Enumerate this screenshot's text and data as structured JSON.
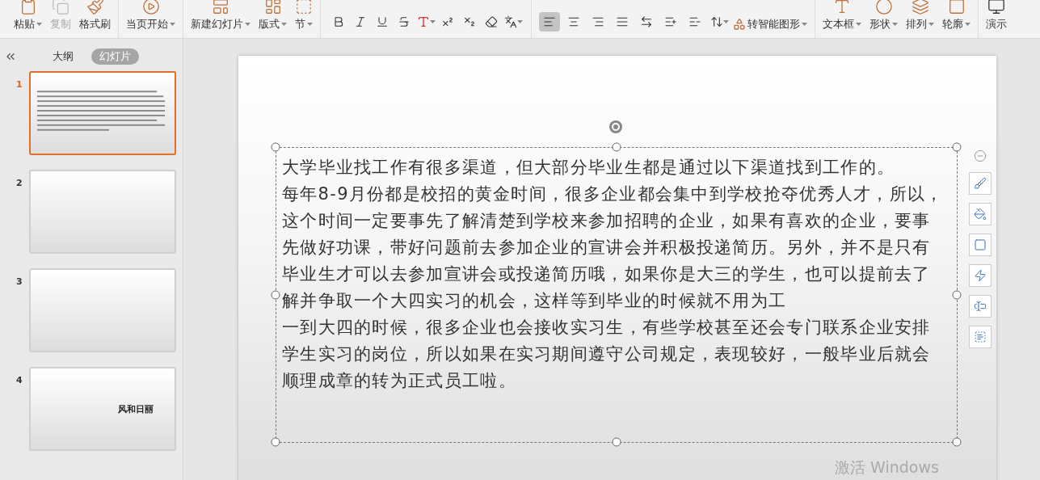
{
  "ribbon": {
    "groups": [
      {
        "items": [
          {
            "kind": "paste",
            "label": "粘贴",
            "dropdown": true,
            "disabled": false
          },
          {
            "kind": "copy",
            "label": "复制",
            "dropdown": false,
            "disabled": true
          },
          {
            "kind": "brush",
            "label": "格式刷",
            "dropdown": false,
            "disabled": false
          }
        ]
      },
      {
        "items": [
          {
            "kind": "play",
            "label": "当页开始",
            "dropdown": true,
            "disabled": false
          }
        ]
      },
      {
        "items": [
          {
            "kind": "newslide",
            "label": "新建幻灯片",
            "dropdown": true,
            "disabled": false
          },
          {
            "kind": "layout",
            "label": "版式",
            "dropdown": true,
            "disabled": false
          },
          {
            "kind": "section",
            "label": "节",
            "dropdown": true,
            "disabled": false
          }
        ]
      }
    ],
    "format_buttons": [
      {
        "kind": "bold"
      },
      {
        "kind": "italic"
      },
      {
        "kind": "underline"
      },
      {
        "kind": "strike"
      },
      {
        "kind": "color",
        "dropdown": true
      },
      {
        "kind": "sup"
      },
      {
        "kind": "sub"
      },
      {
        "kind": "eraser"
      },
      {
        "kind": "phonetic",
        "dropdown": true
      }
    ],
    "align_buttons": [
      {
        "kind": "left",
        "selected": true
      },
      {
        "kind": "center",
        "selected": false
      },
      {
        "kind": "right",
        "selected": false
      },
      {
        "kind": "justify",
        "selected": false
      },
      {
        "kind": "distribute",
        "selected": false
      }
    ],
    "spacing_buttons": [
      {
        "kind": "increase"
      },
      {
        "kind": "decrease"
      },
      {
        "kind": "linespacing",
        "dropdown": true
      }
    ],
    "smart_art": {
      "label": "转智能图形",
      "dropdown": true
    },
    "insert_items": [
      {
        "kind": "textbox",
        "label": "文本框",
        "dropdown": true
      },
      {
        "kind": "shape",
        "label": "形状",
        "dropdown": true
      },
      {
        "kind": "arrange",
        "label": "排列",
        "dropdown": true
      },
      {
        "kind": "outline",
        "label": "轮廓",
        "dropdown": true
      }
    ],
    "cut_tab": {
      "label": "演示"
    }
  },
  "sidebar": {
    "tabs": [
      {
        "label": "大纲",
        "selected": false
      },
      {
        "label": "幻灯片",
        "selected": true
      }
    ],
    "slides": [
      {
        "number": "1",
        "selected": true,
        "kind": "text"
      },
      {
        "number": "2",
        "selected": false,
        "kind": "blank"
      },
      {
        "number": "3",
        "selected": false,
        "kind": "blank"
      },
      {
        "number": "4",
        "selected": false,
        "kind": "title",
        "title": "风和日丽"
      }
    ]
  },
  "slide": {
    "lines": [
      "大学毕业找工作有很多渠道，但大部分毕业生都是通过以下渠道找到工作的。",
      "每年8-9月份都是校招的黄金时间，很多企业都会集中到学校抢夺优秀人才，所以，",
      "这个时间一定要事先了解清楚到学校来参加招聘的企业，如果有喜欢的企业，要事",
      "先做好功课，带好问题前去参加企业的宣讲会并积极投递简历。另外，并不是只有",
      "毕业生才可以去参加宣讲会或投递简历哦，如果你是大三的学生，也可以提前去了",
      "解并争取一个大四实习的机会，这样等到毕业的时候就不用为工",
      "一到大四的时候，很多企业也会接收实习生，有些学校甚至还会专门联系企业安排",
      "学生实习的岗位，所以如果在实习期间遵守公司规定，表现较好，一般毕业后就会",
      "顺理成章的转为正式员工啦。"
    ]
  },
  "float_tools": [
    {
      "kind": "collapse"
    },
    {
      "kind": "brush"
    },
    {
      "kind": "fill"
    },
    {
      "kind": "outline"
    },
    {
      "kind": "animate"
    },
    {
      "kind": "textbox"
    },
    {
      "kind": "textselect"
    }
  ],
  "activation": "激活 Windows"
}
